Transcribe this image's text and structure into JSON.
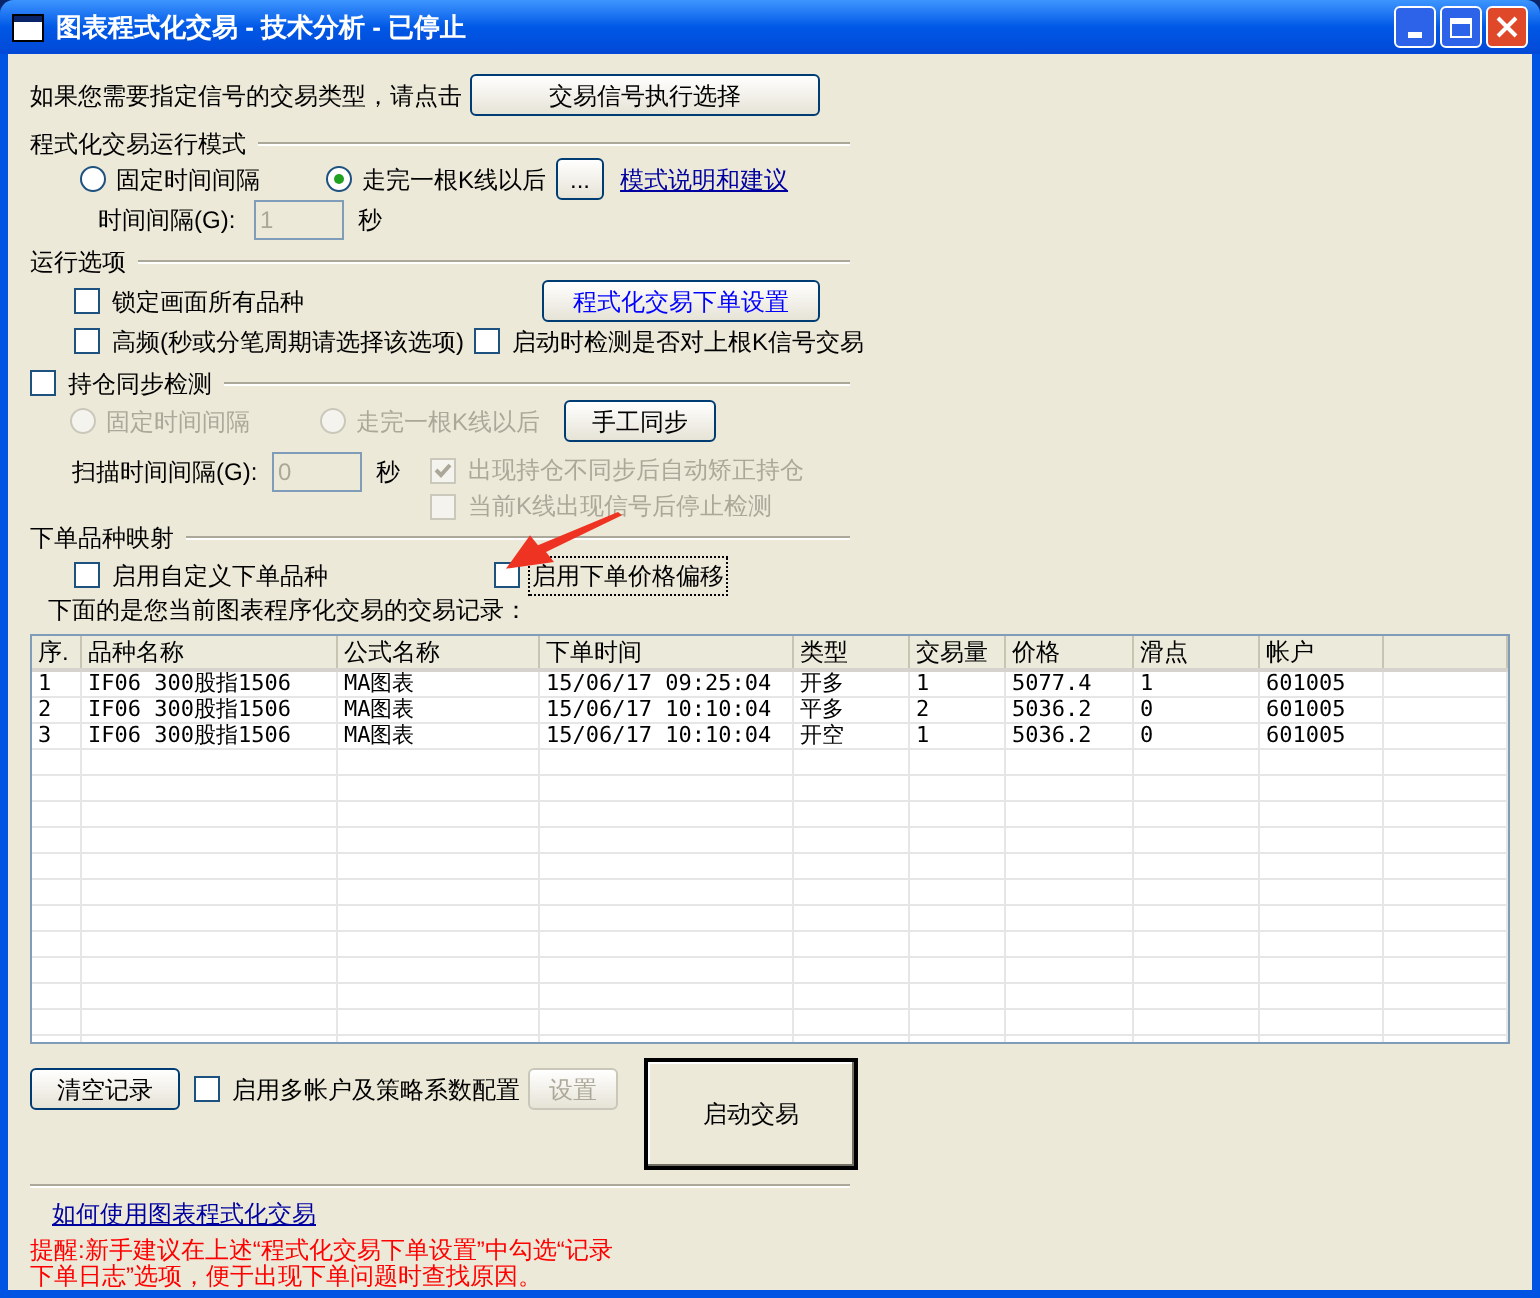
{
  "window": {
    "title": "图表程式化交易 - 技术分析 - 已停止"
  },
  "signal_prompt": {
    "text": "如果您需要指定信号的交易类型，请点击",
    "button": "交易信号执行选择"
  },
  "run_mode": {
    "title": "程式化交易运行模式",
    "options": [
      {
        "label": "固定时间间隔",
        "selected": false
      },
      {
        "label": "走完一根K线以后",
        "selected": true
      }
    ],
    "more_button": "...",
    "link": "模式说明和建议",
    "interval": {
      "label": "时间间隔(G):",
      "value": "1",
      "unit": "秒",
      "disabled": true
    }
  },
  "run_options": {
    "title": "运行选项",
    "order_settings_button": "程式化交易下单设置",
    "checkboxes": [
      {
        "label": "锁定画面所有品种",
        "checked": false
      },
      {
        "label": "高频(秒或分笔周期请选择该选项)",
        "checked": false
      },
      {
        "label": "启动时检测是否对上根K信号交易",
        "checked": false
      }
    ]
  },
  "sync": {
    "label": "持仓同步检测",
    "checked": false,
    "modes": [
      {
        "label": "固定时间间隔",
        "selected": false,
        "disabled": true
      },
      {
        "label": "走完一根K线以后",
        "selected": false,
        "disabled": true
      }
    ],
    "manual_button": "手工同步",
    "scan_interval": {
      "label": "扫描时间间隔(G):",
      "value": "0",
      "unit": "秒",
      "disabled": true
    },
    "checkboxes": [
      {
        "label": "出现持仓不同步后自动矫正持仓",
        "checked": true,
        "disabled": true
      },
      {
        "label": "当前K线出现信号后停止检测",
        "checked": false,
        "disabled": true
      }
    ]
  },
  "mapping": {
    "title": "下单品种映射",
    "checkboxes": [
      {
        "label": "启用自定义下单品种",
        "checked": false,
        "focused": false
      },
      {
        "label": "启用下单价格偏移",
        "checked": false,
        "focused": true
      }
    ]
  },
  "records": {
    "caption": "下面的是您当前图表程序化交易的交易记录：",
    "columns": [
      "序.",
      "品种名称",
      "公式名称",
      "下单时间",
      "类型",
      "交易量",
      "价格",
      "滑点",
      "帐户"
    ],
    "rows": [
      [
        "1",
        "IF06 300股指1506",
        "MA图表",
        "15/06/17 09:25:04",
        "开多",
        "1",
        "5077.4",
        "1",
        "601005"
      ],
      [
        "2",
        "IF06 300股指1506",
        "MA图表",
        "15/06/17 10:10:04",
        "平多",
        "2",
        "5036.2",
        "0",
        "601005"
      ],
      [
        "3",
        "IF06 300股指1506",
        "MA图表",
        "15/06/17 10:10:04",
        "开空",
        "1",
        "5036.2",
        "0",
        "601005"
      ]
    ]
  },
  "bottom": {
    "clear_button": "清空记录",
    "multi_account": {
      "label": "启用多帐户及策略系数配置",
      "checked": false
    },
    "settings_button": {
      "label": "设置",
      "disabled": true
    },
    "start_button": "启动交易"
  },
  "help_link": "如何使用图表程式化交易",
  "reminder": "提醒:新手建议在上述“程式化交易下单设置”中勾选“记录下单日志”选项，便于出现下单问题时查找原因。"
}
